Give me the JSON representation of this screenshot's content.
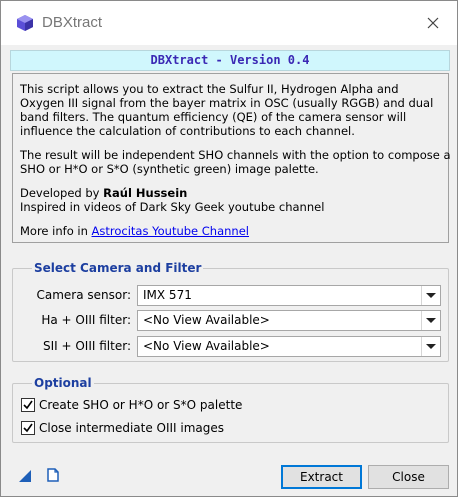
{
  "window": {
    "title": "DBXtract",
    "close_icon": "close-icon",
    "app_icon": "dbxtract-cube-icon"
  },
  "header": {
    "banner": "DBXtract - Version 0.4"
  },
  "info": {
    "lines": [
      "This script allows you to extract the Sulfur II, Hydrogen Alpha and",
      "Oxygen III signal from the bayer matrix in OSC (usually RGGB) and dual",
      "band filters. The quantum efficiency (QE) of the camera sensor will",
      "influence the calculation of contributions to each channel.",
      "The result will be independent SHO channels with the option to compose a",
      "SHO or H*O or S*O (synthetic green) image palette."
    ],
    "developed_prefix": "Developed by ",
    "developer": "Raúl Hussein",
    "inspired": "Inspired in videos of Dark Sky Geek youtube channel",
    "more_info_prefix": "More info in ",
    "more_info_link": "Astrocitas Youtube Channel"
  },
  "camera_group": {
    "title": "Select Camera and Filter",
    "fields": [
      {
        "label": "Camera sensor:",
        "value": "IMX 571"
      },
      {
        "label": "Ha + OIII filter:",
        "value": "<No View Available>"
      },
      {
        "label": "SII + OIII filter:",
        "value": "<No View Available>"
      }
    ]
  },
  "optional_group": {
    "title": "Optional",
    "options": [
      {
        "label": "Create SHO or H*O or S*O palette",
        "checked": true
      },
      {
        "label": "Close intermediate OIII images",
        "checked": true
      }
    ]
  },
  "footer": {
    "icons": [
      "new-instance-icon",
      "documentation-icon"
    ],
    "extract_label": "Extract",
    "close_label": "Close"
  },
  "colors": {
    "banner_bg": "#d0f7fd",
    "banner_text": "#3a28b4",
    "group_title": "#1d3fa0",
    "link": "#0000ee"
  }
}
